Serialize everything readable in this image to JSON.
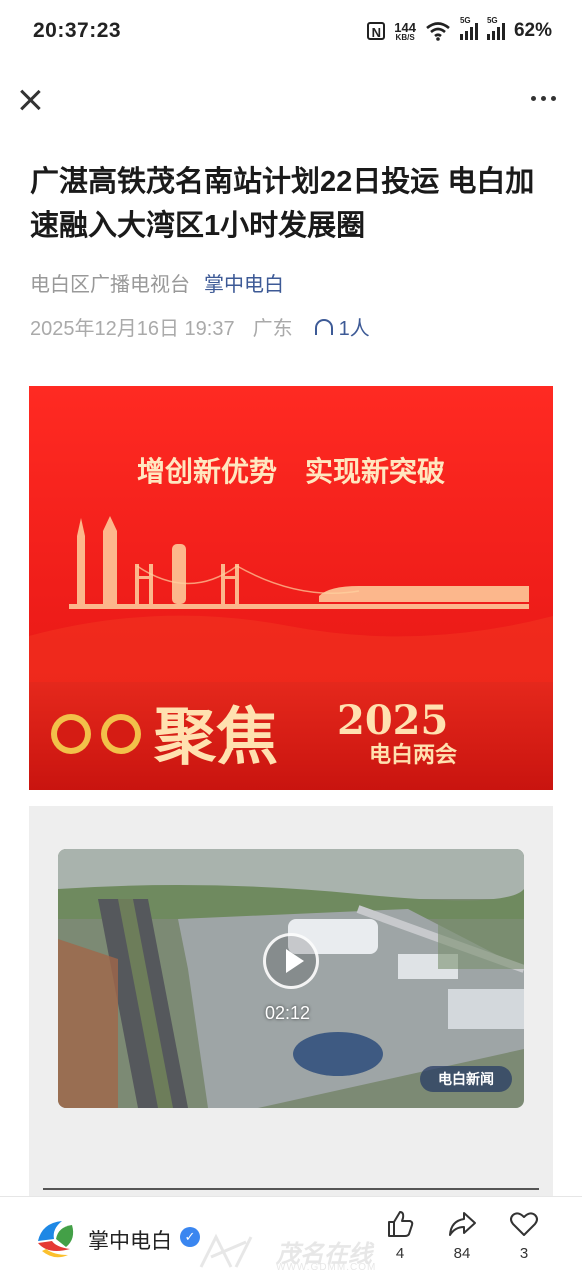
{
  "status_bar": {
    "time": "20:37:23",
    "speed_value": "144",
    "speed_unit": "KB/S",
    "network1": "5G",
    "network2": "5G",
    "battery": "62%"
  },
  "article": {
    "title": "广湛高铁茂名南站计划22日投运 电白加速融入大湾区1小时发展圈",
    "source": "电白区广播电视台",
    "account": "掌中电白",
    "date": "2025年12月16日 19:37",
    "location": "广东",
    "listeners": "1人"
  },
  "banner": {
    "slogan": "增创新优势　实现新突破",
    "big_text": "聚焦",
    "year": "2025",
    "subtitle": "电白两会"
  },
  "video": {
    "duration": "02:12",
    "logo_text": "电白新闻"
  },
  "bottom": {
    "publisher": "掌中电白",
    "likes": "4",
    "shares": "84",
    "favorites": "3"
  },
  "watermark": {
    "text": "茂名在线",
    "url": "WWW.GDMM.COM"
  }
}
